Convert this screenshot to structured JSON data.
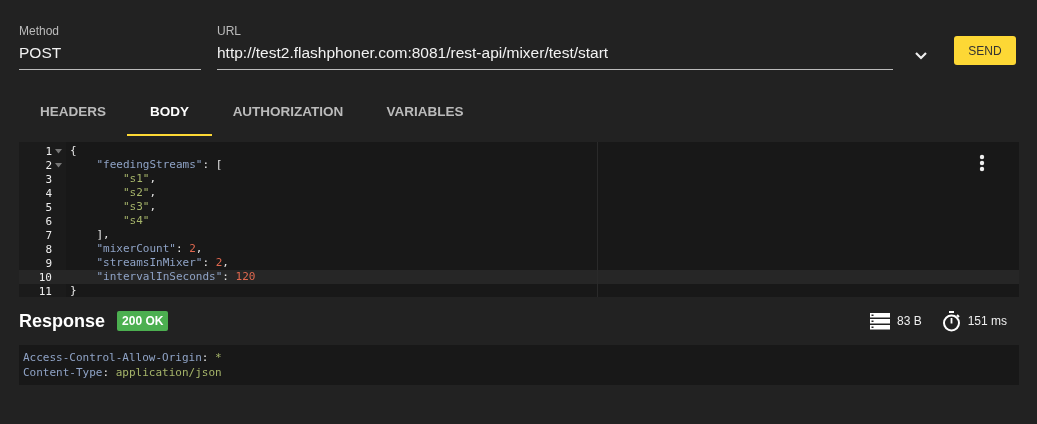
{
  "request": {
    "method": {
      "label": "Method",
      "value": "POST"
    },
    "url": {
      "label": "URL",
      "value": "http://test2.flashphoner.com:8081/rest-api/mixer/test/start"
    },
    "send": "SEND"
  },
  "tabs": [
    {
      "label": "HEADERS",
      "selected": false
    },
    {
      "label": "BODY",
      "selected": true
    },
    {
      "label": "AUTHORIZATION",
      "selected": false
    },
    {
      "label": "VARIABLES",
      "selected": false
    }
  ],
  "editor": {
    "lines": [
      {
        "number": "1",
        "foldable": true,
        "active": false,
        "tokens": [
          {
            "kind": "punct",
            "text": "{"
          }
        ]
      },
      {
        "number": "2",
        "foldable": true,
        "active": false,
        "tokens": [
          {
            "kind": "key",
            "text": "    \"feedingStreams\""
          },
          {
            "kind": "punct",
            "text": ": ["
          }
        ]
      },
      {
        "number": "3",
        "foldable": false,
        "active": false,
        "tokens": [
          {
            "kind": "string",
            "text": "        \"s1\""
          },
          {
            "kind": "punct",
            "text": ","
          }
        ]
      },
      {
        "number": "4",
        "foldable": false,
        "active": false,
        "tokens": [
          {
            "kind": "string",
            "text": "        \"s2\""
          },
          {
            "kind": "punct",
            "text": ","
          }
        ]
      },
      {
        "number": "5",
        "foldable": false,
        "active": false,
        "tokens": [
          {
            "kind": "string",
            "text": "        \"s3\""
          },
          {
            "kind": "punct",
            "text": ","
          }
        ]
      },
      {
        "number": "6",
        "foldable": false,
        "active": false,
        "tokens": [
          {
            "kind": "string",
            "text": "        \"s4\""
          }
        ]
      },
      {
        "number": "7",
        "foldable": false,
        "active": false,
        "tokens": [
          {
            "kind": "punct",
            "text": "    ],"
          }
        ]
      },
      {
        "number": "8",
        "foldable": false,
        "active": false,
        "tokens": [
          {
            "kind": "key",
            "text": "    \"mixerCount\""
          },
          {
            "kind": "punct",
            "text": ": "
          },
          {
            "kind": "number",
            "text": "2"
          },
          {
            "kind": "punct",
            "text": ","
          }
        ]
      },
      {
        "number": "9",
        "foldable": false,
        "active": false,
        "tokens": [
          {
            "kind": "key",
            "text": "    \"streamsInMixer\""
          },
          {
            "kind": "punct",
            "text": ": "
          },
          {
            "kind": "number",
            "text": "2"
          },
          {
            "kind": "punct",
            "text": ","
          }
        ]
      },
      {
        "number": "10",
        "foldable": false,
        "active": true,
        "tokens": [
          {
            "kind": "key",
            "text": "    \"intervalInSeconds\""
          },
          {
            "kind": "punct",
            "text": ": "
          },
          {
            "kind": "number",
            "text": "120"
          }
        ]
      },
      {
        "number": "11",
        "foldable": false,
        "active": false,
        "tokens": [
          {
            "kind": "punct",
            "text": "}"
          }
        ]
      }
    ]
  },
  "response": {
    "title": "Response",
    "status": "200 OK",
    "size": "83 B",
    "time": "151 ms",
    "headers": [
      {
        "tokens": [
          {
            "kind": "key",
            "text": "Access-Control-Allow-Origin"
          },
          {
            "kind": "punct",
            "text": ": "
          },
          {
            "kind": "string",
            "text": "*"
          }
        ]
      },
      {
        "tokens": [
          {
            "kind": "key",
            "text": "Content-Type"
          },
          {
            "kind": "punct",
            "text": ": "
          },
          {
            "kind": "string",
            "text": "application/json"
          }
        ]
      }
    ]
  }
}
